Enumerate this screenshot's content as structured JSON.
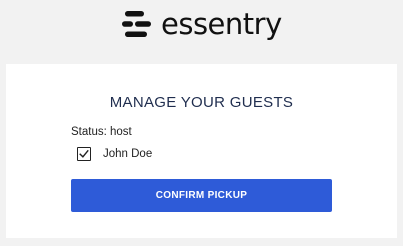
{
  "header": {
    "logo_text": "essentry",
    "logo_icon": "essentry-logo-mark"
  },
  "card": {
    "title": "MANAGE YOUR GUESTS",
    "status": "Status: host",
    "guests": [
      {
        "name": "John Doe",
        "checked": true
      }
    ],
    "confirm_label": "CONFIRM PICKUP"
  },
  "colors": {
    "page_background": "#f2f2f2",
    "card_background": "#ffffff",
    "title_color": "#1f2d4e",
    "button_color": "#2e5bd8"
  }
}
